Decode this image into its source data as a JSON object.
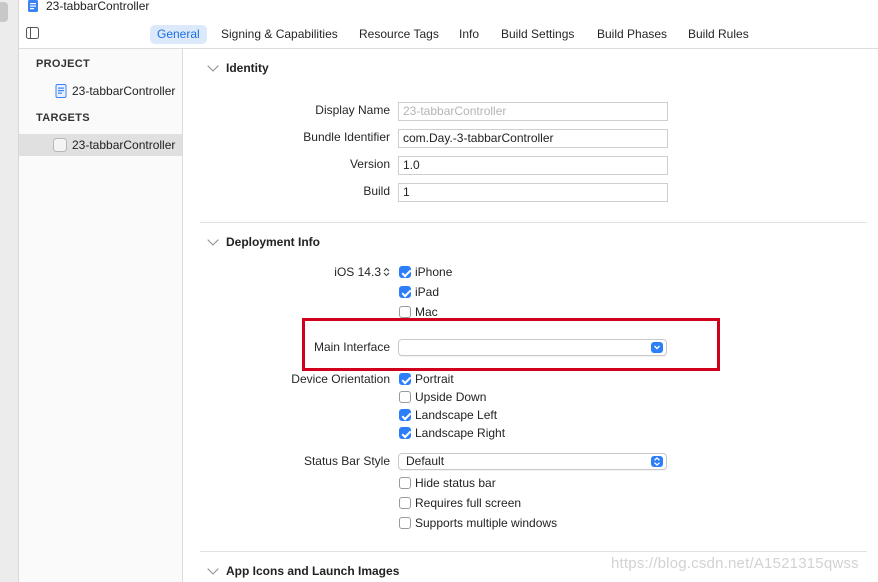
{
  "window": {
    "title": "23-tabbarController"
  },
  "tabs": [
    {
      "label": "General",
      "active": true
    },
    {
      "label": "Signing & Capabilities"
    },
    {
      "label": "Resource Tags"
    },
    {
      "label": "Info"
    },
    {
      "label": "Build Settings"
    },
    {
      "label": "Build Phases"
    },
    {
      "label": "Build Rules"
    }
  ],
  "sidebar": {
    "project_header": "PROJECT",
    "project_item": "23-tabbarController",
    "targets_header": "TARGETS",
    "target_item": "23-tabbarController"
  },
  "identity": {
    "title": "Identity",
    "display_name_label": "Display Name",
    "display_name_placeholder": "23-tabbarController",
    "bundle_id_label": "Bundle Identifier",
    "bundle_id_value": "com.Day.-3-tabbarController",
    "version_label": "Version",
    "version_value": "1.0",
    "build_label": "Build",
    "build_value": "1"
  },
  "deployment": {
    "title": "Deployment Info",
    "ios_version": "iOS 14.3",
    "devices": [
      {
        "label": "iPhone",
        "checked": true
      },
      {
        "label": "iPad",
        "checked": true
      },
      {
        "label": "Mac",
        "checked": false
      }
    ],
    "main_interface_label": "Main Interface",
    "main_interface_value": "",
    "orientation_label": "Device Orientation",
    "orientations": [
      {
        "label": "Portrait",
        "checked": true
      },
      {
        "label": "Upside Down",
        "checked": false
      },
      {
        "label": "Landscape Left",
        "checked": true
      },
      {
        "label": "Landscape Right",
        "checked": true
      }
    ],
    "status_bar_label": "Status Bar Style",
    "status_bar_value": "Default",
    "status_options": [
      {
        "label": "Hide status bar",
        "checked": false
      },
      {
        "label": "Requires full screen",
        "checked": false
      },
      {
        "label": "Supports multiple windows",
        "checked": false
      }
    ]
  },
  "app_icons": {
    "title": "App Icons and Launch Images"
  },
  "watermark": "https://blog.csdn.net/A1521315qwss",
  "colors": {
    "accent": "#2d7ff9",
    "highlight": "#d0021b",
    "tab_active_bg": "#dce9fb"
  }
}
